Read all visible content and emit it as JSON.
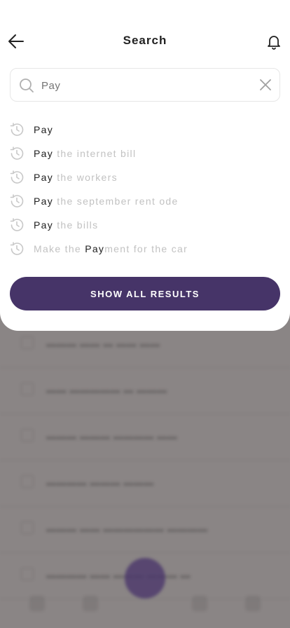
{
  "header": {
    "title": "Search",
    "back_icon": "arrow-left-icon",
    "bell_icon": "bell-icon"
  },
  "search": {
    "value": "",
    "placeholder": "Pay",
    "search_icon": "search-icon",
    "clear_icon": "close-icon"
  },
  "suggestions": [
    {
      "before": "",
      "match": "Pay",
      "after": ""
    },
    {
      "before": "",
      "match": "Pay",
      "after": " the internet bill"
    },
    {
      "before": "",
      "match": "Pay",
      "after": " the workers"
    },
    {
      "before": "",
      "match": "Pay",
      "after": " the september rent ode"
    },
    {
      "before": "",
      "match": "Pay",
      "after": " the bills"
    },
    {
      "before": "Make the ",
      "match": "Pay",
      "after": "ment for the car"
    }
  ],
  "show_all_label": "SHOW ALL RESULTS",
  "colors": {
    "accent": "#463468",
    "overlay": "#8a8585",
    "muted_text": "#c2c2c2"
  }
}
